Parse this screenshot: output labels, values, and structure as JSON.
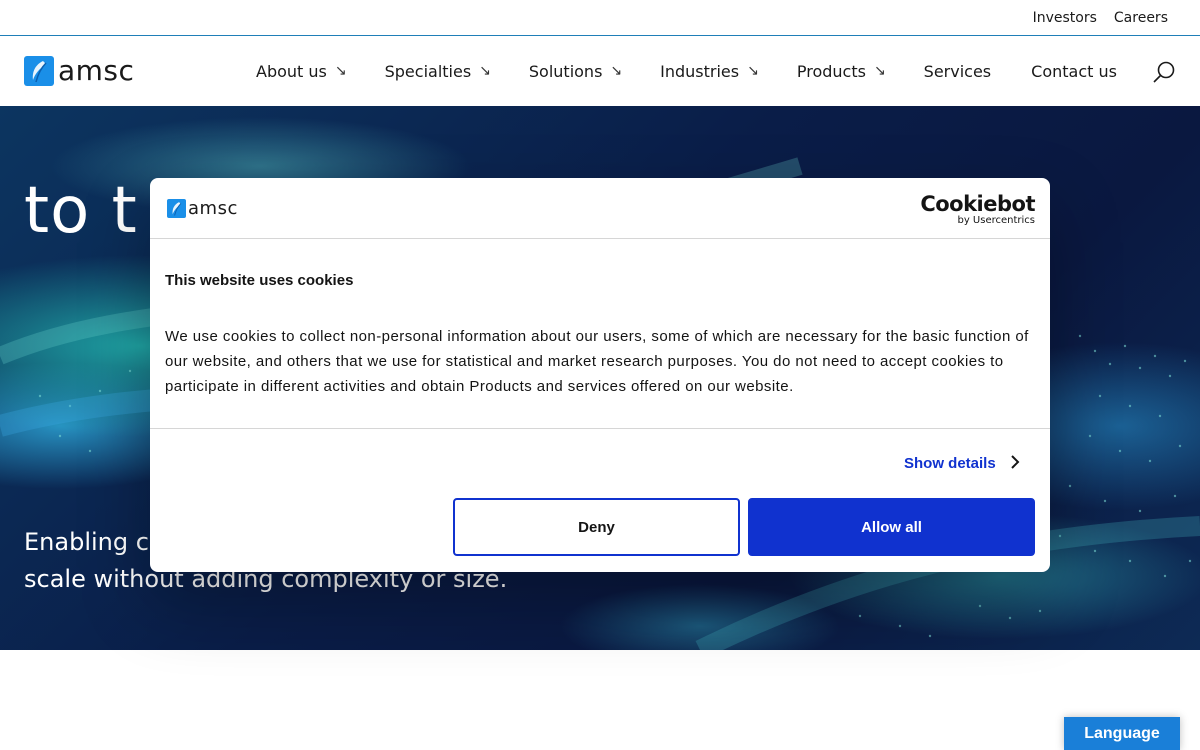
{
  "utility_nav": {
    "investors": "Investors",
    "careers": "Careers"
  },
  "brand": {
    "name": "amsc",
    "color": "#1a8fe8"
  },
  "main_nav": {
    "items": [
      {
        "label": "About us",
        "has_submenu": true
      },
      {
        "label": "Specialties",
        "has_submenu": true
      },
      {
        "label": "Solutions",
        "has_submenu": true
      },
      {
        "label": "Industries",
        "has_submenu": true
      },
      {
        "label": "Products",
        "has_submenu": true
      },
      {
        "label": "Services",
        "has_submenu": false
      },
      {
        "label": "Contact us",
        "has_submenu": false
      }
    ],
    "submenu_arrow": "↘",
    "search_icon": "search-icon"
  },
  "hero": {
    "headline_visible": "to t",
    "subtext_line1_visible": "Enabling c",
    "subtext_line2_visible": "scale without adding complexity or size."
  },
  "cookie_dialog": {
    "brand_name": "amsc",
    "provider_name": "Cookiebot",
    "provider_sub": "by Usercentrics",
    "title": "This website uses cookies",
    "body": "We use cookies to collect non-personal information about our users, some of which are necessary for the basic function of our website, and others that we use for statistical and market research purposes.  You do not need to accept cookies to participate in different activities and obtain Products and services offered on our website.",
    "show_details": "Show details",
    "deny": "Deny",
    "allow_all": "Allow all",
    "accent_color": "#1032cf"
  },
  "language_button": {
    "label": "Language",
    "color": "#1a7fd8"
  }
}
